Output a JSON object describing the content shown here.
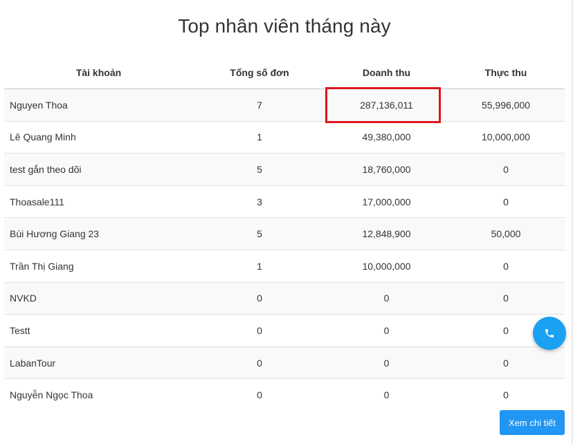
{
  "title": "Top nhân viên tháng này",
  "table": {
    "headers": [
      "Tài khoản",
      "Tổng số đơn",
      "Doanh thu",
      "Thực thu"
    ],
    "rows": [
      {
        "account": "Nguyen Thoa",
        "orders": "7",
        "revenue": "287,136,011",
        "received": "55,996,000"
      },
      {
        "account": "Lê Quang Minh",
        "orders": "1",
        "revenue": "49,380,000",
        "received": "10,000,000"
      },
      {
        "account": "test gắn theo dõi",
        "orders": "5",
        "revenue": "18,760,000",
        "received": "0"
      },
      {
        "account": "Thoasale111",
        "orders": "3",
        "revenue": "17,000,000",
        "received": "0"
      },
      {
        "account": "Bùi Hương Giang 23",
        "orders": "5",
        "revenue": "12,848,900",
        "received": "50,000"
      },
      {
        "account": "Trần Thị Giang",
        "orders": "1",
        "revenue": "10,000,000",
        "received": "0"
      },
      {
        "account": "NVKD",
        "orders": "0",
        "revenue": "0",
        "received": "0"
      },
      {
        "account": "Testt",
        "orders": "0",
        "revenue": "0",
        "received": "0"
      },
      {
        "account": "LabanTour",
        "orders": "0",
        "revenue": "0",
        "received": "0"
      },
      {
        "account": "Nguyễn Ngọc Thoa",
        "orders": "0",
        "revenue": "0",
        "received": "0"
      }
    ]
  },
  "actions": {
    "detail_label": "Xem chi tiết",
    "call_icon": "phone-icon"
  },
  "colors": {
    "accent": "#2196f3",
    "fab": "#1aa1f2",
    "highlight": "#e0151d"
  }
}
